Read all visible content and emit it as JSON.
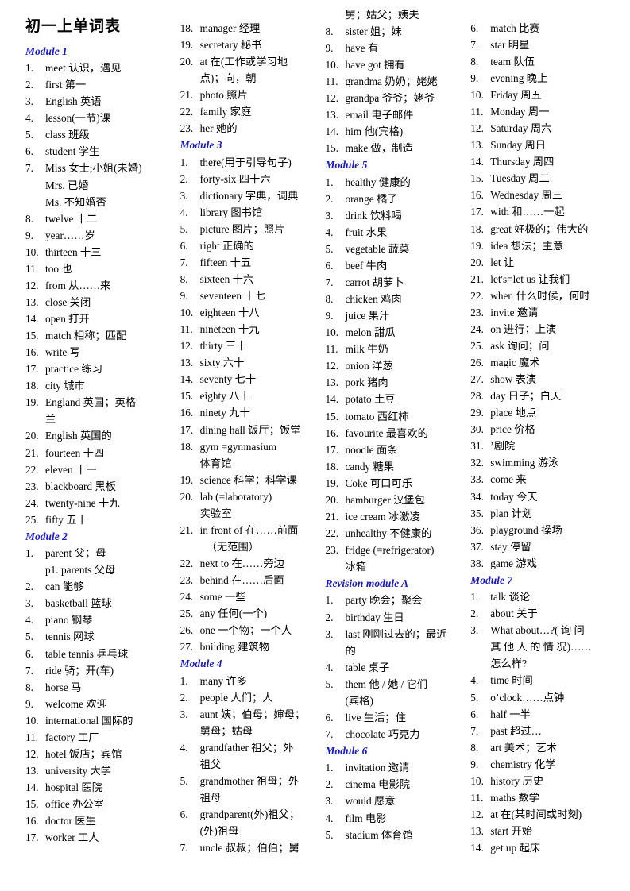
{
  "document": {
    "title": "初一上单词表"
  },
  "columns": [
    {
      "id": "column-1",
      "blocks": [
        {
          "type": "module",
          "label": "Module 1"
        },
        {
          "type": "entry",
          "num": "1.",
          "text": "meet 认识，遇见"
        },
        {
          "type": "entry",
          "num": "2.",
          "text": "first 第一"
        },
        {
          "type": "entry",
          "num": "3.",
          "text": "English  英语"
        },
        {
          "type": "entry",
          "num": "4.",
          "text": "lesson(一节)课"
        },
        {
          "type": "entry",
          "num": "5.",
          "text": "class 班级"
        },
        {
          "type": "entry",
          "num": "6.",
          "text": "student 学生"
        },
        {
          "type": "entry",
          "num": "7.",
          "text": "Miss 女士;小姐(未婚)"
        },
        {
          "type": "cont",
          "text": "Mrs.  已婚"
        },
        {
          "type": "cont",
          "text": "Ms.  不知婚否"
        },
        {
          "type": "entry",
          "num": "8.",
          "text": "twelve 十二"
        },
        {
          "type": "entry",
          "num": "9.",
          "text": "year……岁"
        },
        {
          "type": "entry",
          "num": "10.",
          "text": "thirteen 十三"
        },
        {
          "type": "entry",
          "num": "11.",
          "text": "too 也"
        },
        {
          "type": "entry",
          "num": "12.",
          "text": "from 从……来"
        },
        {
          "type": "entry",
          "num": "13.",
          "text": "close 关闭"
        },
        {
          "type": "entry",
          "num": "14.",
          "text": "open 打开"
        },
        {
          "type": "entry",
          "num": "15.",
          "text": "match 相称；匹配"
        },
        {
          "type": "entry",
          "num": "16.",
          "text": "write 写"
        },
        {
          "type": "entry",
          "num": "17.",
          "text": "practice 练习"
        },
        {
          "type": "entry",
          "num": "18.",
          "text": "city 城市"
        },
        {
          "type": "entry",
          "num": "19.",
          "text": "England  英国；英格"
        },
        {
          "type": "cont",
          "text": "兰"
        },
        {
          "type": "entry",
          "num": "20.",
          "text": "English  英国的"
        },
        {
          "type": "entry",
          "num": "21.",
          "text": "fourteen  十四"
        },
        {
          "type": "entry",
          "num": "22.",
          "text": "eleven  十一"
        },
        {
          "type": "entry",
          "num": "23.",
          "text": "blackboard 黑板"
        },
        {
          "type": "entry",
          "num": "24.",
          "text": "twenty-nine 十九"
        },
        {
          "type": "entry",
          "num": "25.",
          "text": "fifty 五十"
        },
        {
          "type": "module",
          "label": "Module 2"
        },
        {
          "type": "entry",
          "num": "1.",
          "text": "parent 父；母"
        },
        {
          "type": "cont",
          "text": "p1. parents 父母"
        },
        {
          "type": "entry",
          "num": "2.",
          "text": "can 能够"
        },
        {
          "type": "entry",
          "num": "3.",
          "text": "basketball 篮球"
        },
        {
          "type": "entry",
          "num": "4.",
          "text": "piano 钢琴"
        },
        {
          "type": "entry",
          "num": "5.",
          "text": "tennis 网球"
        },
        {
          "type": "entry",
          "num": "6.",
          "text": "table tennis 乒乓球"
        },
        {
          "type": "entry",
          "num": "7.",
          "text": "ride 骑；开(车)"
        },
        {
          "type": "entry",
          "num": "8.",
          "text": "horse 马"
        },
        {
          "type": "entry",
          "num": "9.",
          "text": "welcome 欢迎"
        },
        {
          "type": "entry",
          "num": "10.",
          "text": "international 国际的"
        },
        {
          "type": "entry",
          "num": "11.",
          "text": "factory 工厂"
        },
        {
          "type": "entry",
          "num": "12.",
          "text": "hotel 饭店；宾馆"
        },
        {
          "type": "entry",
          "num": "13.",
          "text": "university 大学"
        },
        {
          "type": "entry",
          "num": "14.",
          "text": "hospital 医院"
        },
        {
          "type": "entry",
          "num": "15.",
          "text": "office 办公室"
        },
        {
          "type": "entry",
          "num": "16.",
          "text": "doctor 医生"
        },
        {
          "type": "entry",
          "num": "17.",
          "text": "worker 工人"
        }
      ]
    },
    {
      "id": "column-2",
      "blocks": [
        {
          "type": "entry",
          "num": "18.",
          "text": "manager 经理"
        },
        {
          "type": "entry",
          "num": "19.",
          "text": "secretary 秘书"
        },
        {
          "type": "entry",
          "num": "20.",
          "text": "at 在(工作或学习地"
        },
        {
          "type": "cont",
          "text": "点)；向，朝"
        },
        {
          "type": "entry",
          "num": "21.",
          "text": "photo  照片"
        },
        {
          "type": "entry",
          "num": "22.",
          "text": "family 家庭"
        },
        {
          "type": "entry",
          "num": "23.",
          "text": "her 她的"
        },
        {
          "type": "module",
          "label": "Module 3"
        },
        {
          "type": "entry",
          "num": "1.",
          "text": "there(用于引导句子)"
        },
        {
          "type": "entry",
          "num": "2.",
          "text": "forty-six 四十六"
        },
        {
          "type": "entry",
          "num": "3.",
          "text": "dictionary  字典，词典"
        },
        {
          "type": "entry",
          "num": "4.",
          "text": "library 图书馆"
        },
        {
          "type": "entry",
          "num": "5.",
          "text": "picture 图片；照片"
        },
        {
          "type": "entry",
          "num": "6.",
          "text": "right 正确的"
        },
        {
          "type": "entry",
          "num": "7.",
          "text": "fifteen  十五"
        },
        {
          "type": "entry",
          "num": "8.",
          "text": "sixteen  十六"
        },
        {
          "type": "entry",
          "num": "9.",
          "text": "seventeen 十七"
        },
        {
          "type": "entry",
          "num": "10.",
          "text": "eighteen 十八"
        },
        {
          "type": "entry",
          "num": "11.",
          "text": "nineteen 十九"
        },
        {
          "type": "entry",
          "num": "12.",
          "text": "thirty 三十"
        },
        {
          "type": "entry",
          "num": "13.",
          "text": "sixty 六十"
        },
        {
          "type": "entry",
          "num": "14.",
          "text": "seventy 七十"
        },
        {
          "type": "entry",
          "num": "15.",
          "text": "eighty 八十"
        },
        {
          "type": "entry",
          "num": "16.",
          "text": "ninety 九十"
        },
        {
          "type": "entry",
          "num": "17.",
          "text": "dining hall  饭厅；饭堂"
        },
        {
          "type": "entry",
          "num": "18.",
          "text": "gym =gymnasium"
        },
        {
          "type": "cont",
          "text": "体育馆"
        },
        {
          "type": "entry",
          "num": "19.",
          "text": "science 科学；科学课"
        },
        {
          "type": "entry",
          "num": "20.",
          "text": "lab (=laboratory)"
        },
        {
          "type": "cont",
          "text": "实验室"
        },
        {
          "type": "entry",
          "num": "21.",
          "text": "in front of 在……前面"
        },
        {
          "type": "cont",
          "indent": true,
          "text": "（无范围）"
        },
        {
          "type": "entry",
          "num": "22.",
          "text": "next to 在……旁边"
        },
        {
          "type": "entry",
          "num": "23.",
          "text": "behind 在……后面"
        },
        {
          "type": "entry",
          "num": "24.",
          "text": "some 一些"
        },
        {
          "type": "entry",
          "num": "25.",
          "text": "any 任何(一个)"
        },
        {
          "type": "entry",
          "num": "26.",
          "text": "one 一个物；一个人"
        },
        {
          "type": "entry",
          "num": "27.",
          "text": "building 建筑物"
        },
        {
          "type": "module",
          "label": "Module 4"
        },
        {
          "type": "entry",
          "num": "1.",
          "text": "many 许多"
        },
        {
          "type": "entry",
          "num": "2.",
          "text": "people 人们；人"
        },
        {
          "type": "entry",
          "num": "3.",
          "text": "aunt 姨；伯母；婶母；"
        },
        {
          "type": "cont",
          "text": "舅母；姑母"
        },
        {
          "type": "entry",
          "num": "4.",
          "text": "grandfather 祖父；外"
        },
        {
          "type": "cont",
          "text": "祖父"
        },
        {
          "type": "entry",
          "num": "5.",
          "text": "grandmother 祖母；外"
        },
        {
          "type": "cont",
          "text": "祖母"
        },
        {
          "type": "entry",
          "num": "6.",
          "text": "grandparent(外)祖父；"
        },
        {
          "type": "cont",
          "text": "(外)祖母"
        },
        {
          "type": "entry",
          "num": "7.",
          "text": "uncle 叔叔；伯伯；舅"
        }
      ]
    },
    {
      "id": "column-3",
      "blocks": [
        {
          "type": "cont",
          "text": "舅；姑父；姨夫"
        },
        {
          "type": "entry",
          "num": "8.",
          "text": "sister 姐；妹"
        },
        {
          "type": "entry",
          "num": "9.",
          "text": "have 有"
        },
        {
          "type": "entry",
          "num": "10.",
          "text": "have got 拥有"
        },
        {
          "type": "entry",
          "num": "11.",
          "text": "grandma 奶奶；姥姥"
        },
        {
          "type": "entry",
          "num": "12.",
          "text": "grandpa 爷爷；姥爷"
        },
        {
          "type": "entry",
          "num": "13.",
          "text": "email 电子邮件"
        },
        {
          "type": "entry",
          "num": "14.",
          "text": "him 他(宾格)"
        },
        {
          "type": "entry",
          "num": "15.",
          "text": "make 做，制造"
        },
        {
          "type": "module",
          "label": "Module 5"
        },
        {
          "type": "entry",
          "num": "1.",
          "text": "healthy 健康的"
        },
        {
          "type": "entry",
          "num": "2.",
          "text": "orange 橘子"
        },
        {
          "type": "entry",
          "num": "3.",
          "text": "drink 饮料喝"
        },
        {
          "type": "entry",
          "num": "4.",
          "text": "fruit 水果"
        },
        {
          "type": "entry",
          "num": "5.",
          "text": "vegetable 蔬菜"
        },
        {
          "type": "entry",
          "num": "6.",
          "text": "beef 牛肉"
        },
        {
          "type": "entry",
          "num": "7.",
          "text": "carrot 胡萝卜"
        },
        {
          "type": "entry",
          "num": "8.",
          "text": "chicken 鸡肉"
        },
        {
          "type": "entry",
          "num": "9.",
          "text": "juice 果汁"
        },
        {
          "type": "entry",
          "num": "10.",
          "text": "melon 甜瓜"
        },
        {
          "type": "entry",
          "num": "11.",
          "text": "milk 牛奶"
        },
        {
          "type": "entry",
          "num": "12.",
          "text": "onion 洋葱"
        },
        {
          "type": "entry",
          "num": "13.",
          "text": "pork 猪肉"
        },
        {
          "type": "entry",
          "num": "14.",
          "text": "potato 土豆"
        },
        {
          "type": "entry",
          "num": "15.",
          "text": "tomato 西红柿"
        },
        {
          "type": "entry",
          "num": "16.",
          "text": "favourite 最喜欢的"
        },
        {
          "type": "entry",
          "num": "17.",
          "text": "noodle 面条"
        },
        {
          "type": "entry",
          "num": "18.",
          "text": "candy 糖果"
        },
        {
          "type": "entry",
          "num": "19.",
          "text": "Coke 可口可乐"
        },
        {
          "type": "entry",
          "num": "20.",
          "text": "hamburger 汉堡包"
        },
        {
          "type": "entry",
          "num": "21.",
          "text": "ice cream 冰激凌"
        },
        {
          "type": "entry",
          "num": "22.",
          "text": "unhealthy 不健康的"
        },
        {
          "type": "entry",
          "num": "23.",
          "text": "fridge  (=refrigerator)"
        },
        {
          "type": "cont",
          "text": "冰箱"
        },
        {
          "type": "module",
          "label": "Revision module A"
        },
        {
          "type": "entry",
          "num": "1.",
          "text": "party 晚会；聚会"
        },
        {
          "type": "entry",
          "num": "2.",
          "text": "birthday 生日"
        },
        {
          "type": "entry",
          "num": "3.",
          "text": "last 刚刚过去的；最近"
        },
        {
          "type": "cont",
          "text": "的"
        },
        {
          "type": "entry",
          "num": "4.",
          "text": "table 桌子"
        },
        {
          "type": "entry",
          "num": "5.",
          "text": "them 他 / 她 / 它们"
        },
        {
          "type": "cont",
          "text": "(宾格)"
        },
        {
          "type": "entry",
          "num": "6.",
          "text": "live 生活；住"
        },
        {
          "type": "entry",
          "num": "7.",
          "text": "chocolate 巧克力"
        },
        {
          "type": "module",
          "label": "Module 6"
        },
        {
          "type": "entry",
          "num": "1.",
          "text": "invitation 邀请"
        },
        {
          "type": "entry",
          "num": "2.",
          "text": "cinema 电影院"
        },
        {
          "type": "entry",
          "num": "3.",
          "text": "would 愿意"
        },
        {
          "type": "entry",
          "num": "4.",
          "text": "film 电影"
        },
        {
          "type": "entry",
          "num": "5.",
          "text": "stadium 体育馆"
        }
      ]
    },
    {
      "id": "column-4",
      "blocks": [
        {
          "type": "entry",
          "num": "6.",
          "text": "match 比赛"
        },
        {
          "type": "entry",
          "num": "7.",
          "text": "star 明星"
        },
        {
          "type": "entry",
          "num": "8.",
          "text": "team 队伍"
        },
        {
          "type": "entry",
          "num": "9.",
          "text": "evening 晚上"
        },
        {
          "type": "entry",
          "num": "10.",
          "text": "Friday 周五"
        },
        {
          "type": "entry",
          "num": "11.",
          "text": "Monday 周一"
        },
        {
          "type": "entry",
          "num": "12.",
          "text": "Saturday 周六"
        },
        {
          "type": "entry",
          "num": "13.",
          "text": "Sunday 周日"
        },
        {
          "type": "entry",
          "num": "14.",
          "text": "Thursday 周四"
        },
        {
          "type": "entry",
          "num": "15.",
          "text": "Tuesday 周二"
        },
        {
          "type": "entry",
          "num": "16.",
          "text": "Wednesday 周三"
        },
        {
          "type": "entry",
          "num": "17.",
          "text": "with 和……一起"
        },
        {
          "type": "entry",
          "num": "18.",
          "text": "great 好极的；伟大的"
        },
        {
          "type": "entry",
          "num": "19.",
          "text": "idea 想法；主意"
        },
        {
          "type": "entry",
          "num": "20.",
          "text": "let 让"
        },
        {
          "type": "entry",
          "num": "21.",
          "text": "let's=let us 让我们"
        },
        {
          "type": "entry",
          "num": "22.",
          "text": "when 什么时候，何时"
        },
        {
          "type": "entry",
          "num": "23.",
          "text": "invite 邀请"
        },
        {
          "type": "entry",
          "num": "24.",
          "text": "on 进行；上演"
        },
        {
          "type": "entry",
          "num": "25.",
          "text": "ask 询问；问"
        },
        {
          "type": "entry",
          "num": "26.",
          "text": "magic 魔术"
        },
        {
          "type": "entry",
          "num": "27.",
          "text": "show 表演"
        },
        {
          "type": "entry",
          "num": "28.",
          "text": "day 日子；白天"
        },
        {
          "type": "entry",
          "num": "29.",
          "text": "place 地点"
        },
        {
          "type": "entry",
          "num": "30.",
          "text": "price 价格"
        },
        {
          "type": "entry",
          "num": "31.",
          "text": "’剧院"
        },
        {
          "type": "entry",
          "num": "32.",
          "text": "swimming 游泳"
        },
        {
          "type": "entry",
          "num": "33.",
          "text": "come 来"
        },
        {
          "type": "entry",
          "num": "34.",
          "text": "today 今天"
        },
        {
          "type": "entry",
          "num": "35.",
          "text": "plan 计划"
        },
        {
          "type": "entry",
          "num": "36.",
          "text": "playground 操场"
        },
        {
          "type": "entry",
          "num": "37.",
          "text": "stay 停留"
        },
        {
          "type": "entry",
          "num": "38.",
          "text": "game 游戏"
        },
        {
          "type": "module",
          "label": "Module 7"
        },
        {
          "type": "entry",
          "num": "1.",
          "text": "talk 谈论"
        },
        {
          "type": "entry",
          "num": "2.",
          "text": "about 关于"
        },
        {
          "type": "entry",
          "num": "3.",
          "text": "What  about…?( 询 问"
        },
        {
          "type": "cont",
          "text": "其 他 人 的 情 况)……"
        },
        {
          "type": "cont",
          "text": "怎么样?"
        },
        {
          "type": "entry",
          "num": "4.",
          "text": "time 时间"
        },
        {
          "type": "entry",
          "num": "5.",
          "text": "o’clock……点钟"
        },
        {
          "type": "entry",
          "num": "6.",
          "text": "half 一半"
        },
        {
          "type": "entry",
          "num": "7.",
          "text": "past 超过…"
        },
        {
          "type": "entry",
          "num": "8.",
          "text": "art 美术；艺术"
        },
        {
          "type": "entry",
          "num": "9.",
          "text": "chemistry 化学"
        },
        {
          "type": "entry",
          "num": "10.",
          "text": "history 历史"
        },
        {
          "type": "entry",
          "num": "11.",
          "text": "maths 数学"
        },
        {
          "type": "entry",
          "num": "12.",
          "text": "at 在(某时间或时刻)"
        },
        {
          "type": "entry",
          "num": "13.",
          "text": "start 开始"
        },
        {
          "type": "entry",
          "num": "14.",
          "text": "get up 起床"
        }
      ]
    }
  ]
}
